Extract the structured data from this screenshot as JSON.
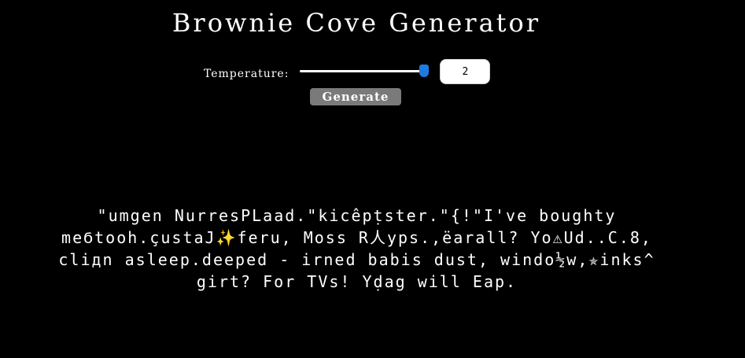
{
  "header": {
    "title": "Brownie Cove Generator"
  },
  "controls": {
    "temperature_label": "Temperature:",
    "temperature_value": "2",
    "temperature_slider_fraction": 1.0,
    "generate_label": "Generate"
  },
  "output": {
    "text": "\"umgen NurresPLaad.\"kicêpṭster.\"{!\"I've boughty meϬtooh.çustaJ✨feru, Moss R人yps.,ëarall? Yo⚠Ud..C.8, cliдn asleep.deeped - irned babis dust, windo½w,✯inks^ girt? For TVs! Yḍag will Eap."
  },
  "colors": {
    "background": "#000000",
    "text": "#ffffff",
    "slider_thumb": "#1f7ae0",
    "button_background": "#7a7a7a"
  }
}
